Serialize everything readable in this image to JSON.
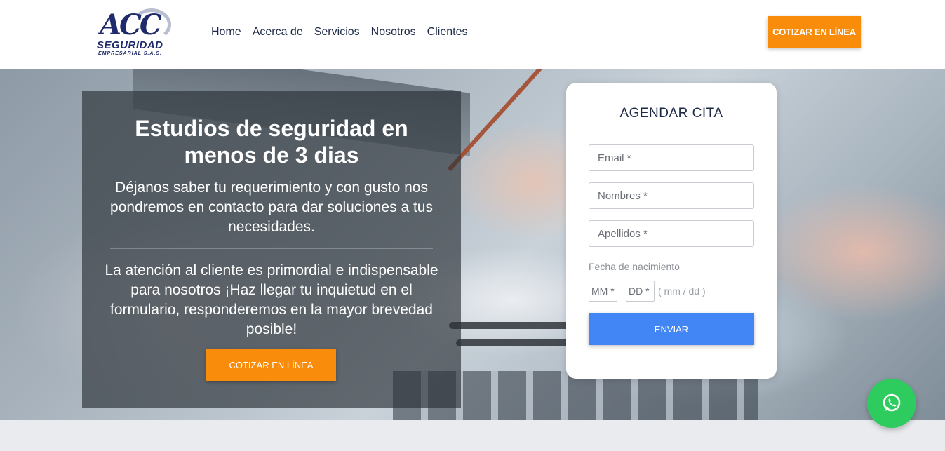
{
  "logo": {
    "main": "ACC",
    "line1": "SEGURIDAD",
    "line2": "EMPRESARIAL S.A.S."
  },
  "nav": {
    "items": [
      {
        "label": "Home"
      },
      {
        "label": "Acerca de"
      },
      {
        "label": "Servicios"
      },
      {
        "label": "Nosotros"
      },
      {
        "label": "Clientes"
      }
    ]
  },
  "header": {
    "cta_label": "COTIZAR EN LÍNEA"
  },
  "hero": {
    "title": "Estudios de seguridad en menos de 3 dias",
    "subtitle": "Déjanos saber tu requerimiento y con gusto nos pondremos en contacto para dar soluciones a tus necesidades.",
    "text": "La atención al cliente es primordial e indispensable para nosotros ¡Haz llegar tu inquietud en el formulario, responderemos en la mayor brevedad posible!",
    "cta_label": "COTIZAR EN LÍNEA"
  },
  "form": {
    "title": "AGENDAR CITA",
    "email_placeholder": "Email *",
    "nombres_placeholder": "Nombres *",
    "apellidos_placeholder": "Apellidos *",
    "dob_label": "Fecha de nacimiento",
    "mm_placeholder": "MM *",
    "dd_placeholder": "DD *",
    "dob_hint": "( mm / dd )",
    "submit_label": "ENVIAR"
  },
  "icons": {
    "whatsapp": "whatsapp-icon"
  },
  "colors": {
    "orange": "#f98c0a",
    "blue": "#4285f4",
    "navy": "#1c2a48",
    "whatsapp_green": "#2ecc5f"
  }
}
